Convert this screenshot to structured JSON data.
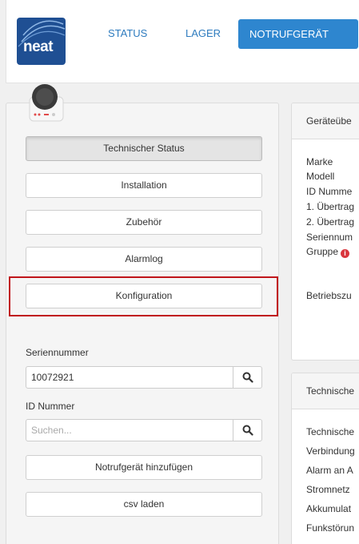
{
  "brand": {
    "logo_text": "neat"
  },
  "nav": {
    "items": [
      {
        "label": "STATUS"
      },
      {
        "label": "LAGER"
      },
      {
        "label": "NOTRUFGERÄT"
      }
    ]
  },
  "sidebar": {
    "menu": [
      {
        "label": "Technischer Status"
      },
      {
        "label": "Installation"
      },
      {
        "label": "Zubehör"
      },
      {
        "label": "Alarmlog"
      },
      {
        "label": "Konfiguration"
      }
    ],
    "serial_label": "Seriennummer",
    "serial_value": "10072921",
    "id_label": "ID Nummer",
    "id_placeholder": "Suchen...",
    "add_device_label": "Notrufgerät hinzufügen",
    "csv_label": "csv laden"
  },
  "overview_panel": {
    "title": "Geräteübe",
    "rows": [
      "Marke",
      "Modell",
      "ID Numme",
      "1. Übertrag",
      "2. Übertrag",
      "Seriennum",
      "Gruppe"
    ],
    "status_row": "Betriebszu"
  },
  "tech_panel": {
    "title": "Technische",
    "rows": [
      "Technische",
      "Verbindung",
      "Alarm an A",
      "Stromnetz",
      "Akkumulat",
      "Funkstörun"
    ]
  },
  "colors": {
    "accent": "#2e86cf",
    "highlight": "#c0151b",
    "logo_bg": "#1f4f93"
  }
}
